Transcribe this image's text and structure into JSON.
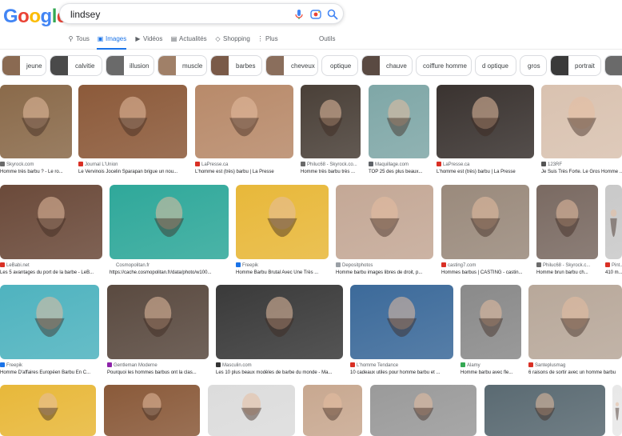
{
  "logo": "Google",
  "search": {
    "query": "lindsey"
  },
  "tabs": [
    {
      "label": "Tous",
      "icon": "magnify-icon"
    },
    {
      "label": "Images",
      "icon": "image-icon",
      "active": true
    },
    {
      "label": "Vidéos",
      "icon": "video-icon"
    },
    {
      "label": "Actualités",
      "icon": "news-icon"
    },
    {
      "label": "Shopping",
      "icon": "tag-icon"
    },
    {
      "label": "Plus",
      "icon": "more-icon"
    }
  ],
  "tools_label": "Outils",
  "chips": [
    "jeune",
    "calvitie",
    "illusion",
    "muscle",
    "barbes",
    "cheveux",
    "optique",
    "chauve",
    "coiffure homme",
    "d optique",
    "gros",
    "portrait"
  ],
  "results": [
    {
      "source": "Skyrock.com",
      "title": "Homme très barbu ? - Le ro...",
      "color": "#8a6a4a",
      "favicon": "#6b6b6b"
    },
    {
      "source": "Journal L'Union",
      "title": "Le Vervinois Jocelin Sparapan brigue un nou...",
      "color": "#8c5a3a",
      "favicon": "#d93025"
    },
    {
      "source": "LaPresse.ca",
      "title": "L'homme est (très) barbu | La Presse",
      "color": "#b88a6a",
      "favicon": "#d93025"
    },
    {
      "source": "Philuc68 - Skyrock.co...",
      "title": "Homme très barbu très ...",
      "color": "#4a4038",
      "favicon": "#6b6b6b"
    },
    {
      "source": "Maquillage.com",
      "title": "TOP 25 des plus beaux...",
      "color": "#7fa7a7",
      "favicon": "#5f6368"
    },
    {
      "source": "LaPresse.ca",
      "title": "L'homme est (très) barbu | La Presse",
      "color": "#3a3330",
      "favicon": "#d93025"
    },
    {
      "source": "123RF",
      "title": "Je Suis Très Forte. Le Gros Homme ...",
      "color": "#d9c2b0",
      "favicon": "#555555"
    },
    {
      "source": "LeBabi.net",
      "title": "Les 5 avantages du port de la barbe - LeB...",
      "color": "#6b4a3a",
      "favicon": "#d93025"
    },
    {
      "source": "Cosmopolitan.fr",
      "title": "https://cache.cosmopolitan.fr/data/photo/w100...",
      "color": "#2fa89a",
      "favicon": "#ffffff"
    },
    {
      "source": "Freepik",
      "title": "Homme Barbu Brutal Avec Une Très ...",
      "color": "#e8b83a",
      "favicon": "#1a73e8"
    },
    {
      "source": "Depositphotos",
      "title": "Homme barbu images libres de droit, p...",
      "color": "#c4a896",
      "favicon": "#9aa0a6"
    },
    {
      "source": "casting7.com",
      "title": "Hommes barbus | CASTING - castin...",
      "color": "#9a8a7c",
      "favicon": "#d93025"
    },
    {
      "source": "Philuc68 - Skyrock.c...",
      "title": "Homme brun barbu ch...",
      "color": "#7a6a62",
      "favicon": "#6b6b6b"
    },
    {
      "source": "Pint...",
      "title": "410 m...",
      "color": "#c9c9c9",
      "favicon": "#d93025"
    },
    {
      "source": "Freepik",
      "title": "Homme D'affaires Européen Barbu En C...",
      "color": "#4fb3bf",
      "favicon": "#1a73e8"
    },
    {
      "source": "Gentleman Moderne",
      "title": "Pourquoi les hommes barbus ont la clas...",
      "color": "#5a4a40",
      "favicon": "#8e24aa"
    },
    {
      "source": "Masculin.com",
      "title": "Les 10 plus beaux modèles de barbe du monde - Ma...",
      "color": "#3a3a3a",
      "favicon": "#333333"
    },
    {
      "source": "L'homme Tendance",
      "title": "10 cadeaux utiles pour homme barbu et ...",
      "color": "#3c6a9a",
      "favicon": "#d93025"
    },
    {
      "source": "Alamy",
      "title": "Homme barbu avec fle...",
      "color": "#8a8a8a",
      "favicon": "#34a853"
    },
    {
      "source": "Santeplusmag",
      "title": "6 raisons de sortir avec un homme barbu",
      "color": "#b8a89a",
      "favicon": "#d93025"
    },
    {
      "source": "",
      "title": "",
      "color": "#e8b83a",
      "favicon": "#ffffff"
    },
    {
      "source": "",
      "title": "",
      "color": "#8a5a3a",
      "favicon": "#ffffff"
    },
    {
      "source": "",
      "title": "",
      "color": "#dcdcdc",
      "favicon": "#ffffff"
    },
    {
      "source": "",
      "title": "",
      "color": "#c8a890",
      "favicon": "#ffffff"
    },
    {
      "source": "",
      "title": "",
      "color": "#9a9a9a",
      "favicon": "#ffffff"
    },
    {
      "source": "",
      "title": "",
      "color": "#5a6a72",
      "favicon": "#ffffff"
    },
    {
      "source": "",
      "title": "",
      "color": "#e8e8e8",
      "favicon": "#ffffff"
    }
  ]
}
